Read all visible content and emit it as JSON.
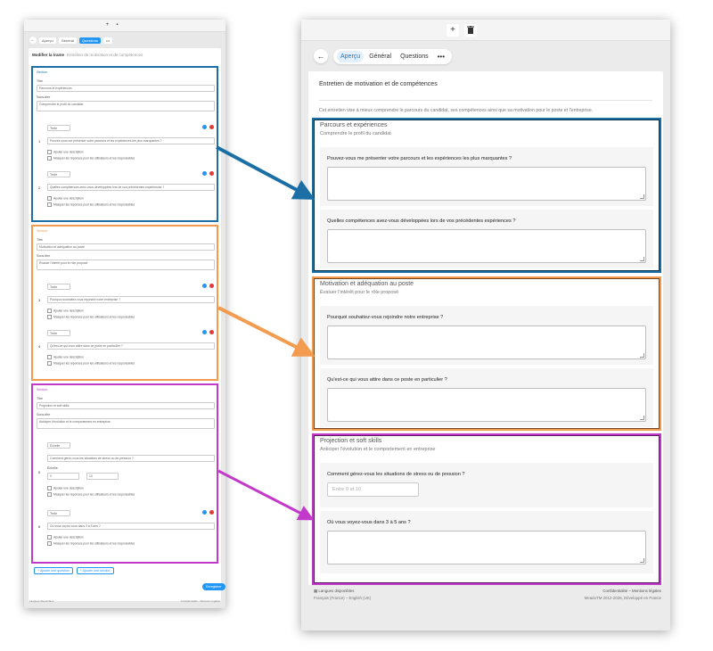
{
  "colors": {
    "section_1": "#1b6fa5",
    "section_2": "#f39c4f",
    "section_3": "#c23ac9",
    "accent": "#2196f3"
  },
  "editor": {
    "toolbar_icons": [
      "plus-icon",
      "trash-icon"
    ],
    "tabs": [
      {
        "label": "Aperçu",
        "active": false
      },
      {
        "label": "Général",
        "active": false
      },
      {
        "label": "Questions",
        "active": true
      }
    ],
    "more_label": "•••",
    "title": "Modifier la trame",
    "title_sub": "Entretien de motivation et de compétences",
    "sections": [
      {
        "header": "Section",
        "title_label": "Titre",
        "title_value": "Parcours et expériences",
        "desc_label": "Sous-titre",
        "desc_value": "Comprendre le profil du candidat",
        "questions": [
          {
            "num": "1",
            "type": "Texte",
            "text": "Pouvez-vous me présenter votre parcours et les expériences les plus marquantes ?",
            "chk1": "Ajouter une description",
            "chk2": "Masquer les réponses pour les utilisateurs et les responsables"
          },
          {
            "num": "2",
            "type": "Texte",
            "text": "Quelles compétences avez-vous développées lors de vos précédentes expériences ?",
            "chk1": "Ajouter une description",
            "chk2": "Masquer les réponses pour les utilisateurs et les responsables"
          }
        ]
      },
      {
        "header": "Section",
        "title_label": "Titre",
        "title_value": "Motivation et adéquation au poste",
        "desc_label": "Sous-titre",
        "desc_value": "Évaluer l'intérêt pour le rôle proposé",
        "questions": [
          {
            "num": "3",
            "type": "Texte",
            "text": "Pourquoi souhaitez-vous rejoindre notre entreprise ?",
            "chk1": "Ajouter une description",
            "chk2": "Masquer les réponses pour les utilisateurs et les responsables"
          },
          {
            "num": "4",
            "type": "Texte",
            "text": "Qu'est-ce qui vous attire dans ce poste en particulier ?",
            "chk1": "Ajouter une description",
            "chk2": "Masquer les réponses pour les utilisateurs et les responsables"
          }
        ]
      },
      {
        "header": "Section",
        "title_label": "Titre",
        "title_value": "Projection et soft skills",
        "desc_label": "Sous-titre",
        "desc_value": "Anticiper l'évolution et le comportement en entreprise",
        "questions": [
          {
            "num": "5",
            "type": "Échelle",
            "text": "Comment gérez-vous les situations de stress ou de pression ?",
            "scale_label": "Échelle",
            "scale_min": "0",
            "scale_max": "10",
            "chk1": "Ajouter une description",
            "chk2": "Masquer les réponses pour les utilisateurs et les responsables"
          },
          {
            "num": "6",
            "type": "Texte",
            "text": "Où vous voyez-vous dans 3 à 5 ans ?",
            "chk1": "Ajouter une description",
            "chk2": "Masquer les réponses pour les utilisateurs et les responsables"
          }
        ]
      }
    ],
    "add_question": "+ Ajouter une question",
    "add_section": "+ Ajouter une section",
    "save": "Enregistrer",
    "footer_left": "Langues disponibles",
    "footer_right": "Confidentialité · Mentions légales"
  },
  "preview": {
    "toolbar_icons": [
      "plus-icon",
      "trash-icon"
    ],
    "tabs": [
      {
        "label": "Aperçu",
        "active": true
      },
      {
        "label": "Général",
        "active": false
      },
      {
        "label": "Questions",
        "active": false
      }
    ],
    "more_label": "•••",
    "form_title": "Entretien de motivation et de compétences",
    "form_description": "Cet entretien vise à mieux comprendre le parcours du candidat, ses compétences ainsi que sa motivation pour le poste et l'entreprise.",
    "sections": [
      {
        "title": "Parcours et expériences",
        "subtitle": "Comprendre le profil du candidat",
        "questions": [
          {
            "label": "Pouvez-vous me présenter votre parcours et les expériences les plus marquantes ?"
          },
          {
            "label": "Quelles compétences avez-vous développées lors de vos précédentes expériences ?"
          }
        ]
      },
      {
        "title": "Motivation et adéquation au poste",
        "subtitle": "Évaluer l'intérêt pour le rôle proposé",
        "questions": [
          {
            "label": "Pourquoi souhaitez-vous rejoindre notre entreprise ?"
          },
          {
            "label": "Qu'est-ce qui vous attire dans ce poste en particulier ?"
          }
        ]
      },
      {
        "title": "Projection et soft skills",
        "subtitle": "Anticiper l'évolution et le comportement en entreprise",
        "questions": [
          {
            "label": "Comment gérez-vous les situations de stress ou de pression ?",
            "placeholder": "Entre 0 et 10"
          },
          {
            "label": "Où vous voyez-vous dans 3 à 5 ans ?"
          }
        ]
      }
    ],
    "footer": {
      "languages_title": "Langues disponibles",
      "languages": "Français (France) – English (UK)",
      "right_line1": "Confidentialité – Mentions légales",
      "right_line2": "MeadoTM 2012-2026, Développé en France"
    }
  }
}
